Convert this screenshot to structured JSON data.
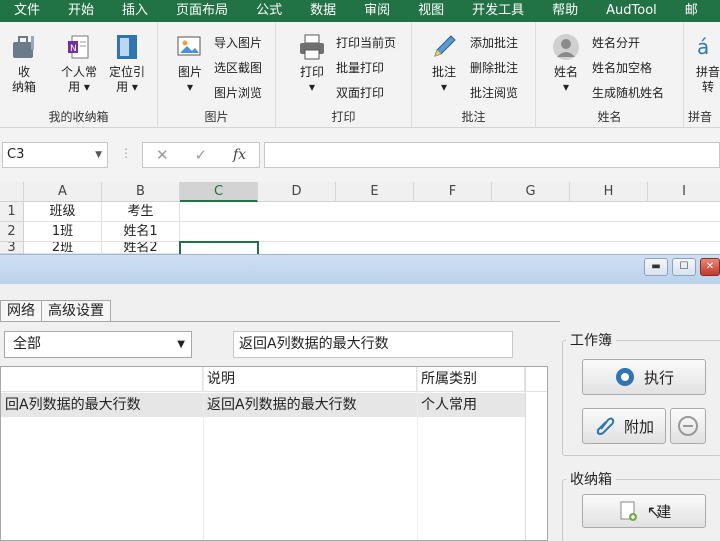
{
  "menu": {
    "tabs": [
      "文件",
      "开始",
      "插入",
      "页面布局",
      "公式",
      "数据",
      "审阅",
      "视图",
      "开发工具",
      "帮助",
      "AudTool",
      "邮"
    ]
  },
  "ribbon": {
    "groups": {
      "my_box": {
        "label": "我的收纳箱",
        "buttons": [
          {
            "label1": "收",
            "label2": "纳箱"
          },
          {
            "label1": "个人常",
            "label2": "用"
          },
          {
            "label1": "定位引",
            "label2": "用"
          }
        ]
      },
      "picture": {
        "label": "图片",
        "big": {
          "label1": "图片",
          "label2": ""
        },
        "small": [
          "导入图片",
          "选区截图",
          "图片浏览"
        ]
      },
      "print": {
        "label": "打印",
        "big": {
          "label1": "打印",
          "label2": ""
        },
        "small": [
          "打印当前页",
          "批量打印",
          "双面打印"
        ]
      },
      "comment": {
        "label": "批注",
        "big": {
          "label1": "批注",
          "label2": ""
        },
        "small": [
          "添加批注",
          "删除批注",
          "批注阅览"
        ]
      },
      "name": {
        "label": "姓名",
        "big": {
          "label1": "姓名",
          "label2": ""
        },
        "small": [
          "姓名分开",
          "姓名加空格",
          "生成随机姓名"
        ]
      },
      "pinyin": {
        "label": "拼音",
        "big": {
          "label1": "拼音",
          "label2": "转"
        }
      }
    }
  },
  "formula_bar": {
    "name_box": "C3",
    "cancel_symbol": "✕",
    "confirm_symbol": "✓",
    "fx_symbol": "fx",
    "formula": ""
  },
  "sheet": {
    "columns": [
      "A",
      "B",
      "C",
      "D",
      "E",
      "F",
      "G",
      "H",
      "I"
    ],
    "selected_column": "C",
    "rows": [
      {
        "num": "1",
        "cells": [
          "班级",
          "考生"
        ]
      },
      {
        "num": "2",
        "cells": [
          "1班",
          "姓名1"
        ]
      },
      {
        "num": "3",
        "cells": [
          "2班",
          "姓名2"
        ]
      }
    ],
    "active_cell": "C3"
  },
  "dialog": {
    "window_buttons": {
      "minimize": "▬",
      "maximize": "☐",
      "close": "✕"
    },
    "tabs": [
      "网络",
      "高级设置"
    ],
    "category_select": "全部",
    "search_text": "返回A列数据的最大行数",
    "list": {
      "headers": [
        "",
        "说明",
        "所属类别"
      ],
      "rows": [
        {
          "name": "回A列数据的最大行数",
          "desc": "返回A列数据的最大行数",
          "category": "个人常用"
        }
      ]
    },
    "workbook": {
      "label": "工作簿",
      "execute": "执行",
      "attach": "附加"
    },
    "box": {
      "label": "收纳箱",
      "new": "建"
    }
  },
  "colors": {
    "excel_green": "#217346",
    "ribbon_bg": "#f3f3f3",
    "dialog_bg": "#f0f0f0"
  }
}
